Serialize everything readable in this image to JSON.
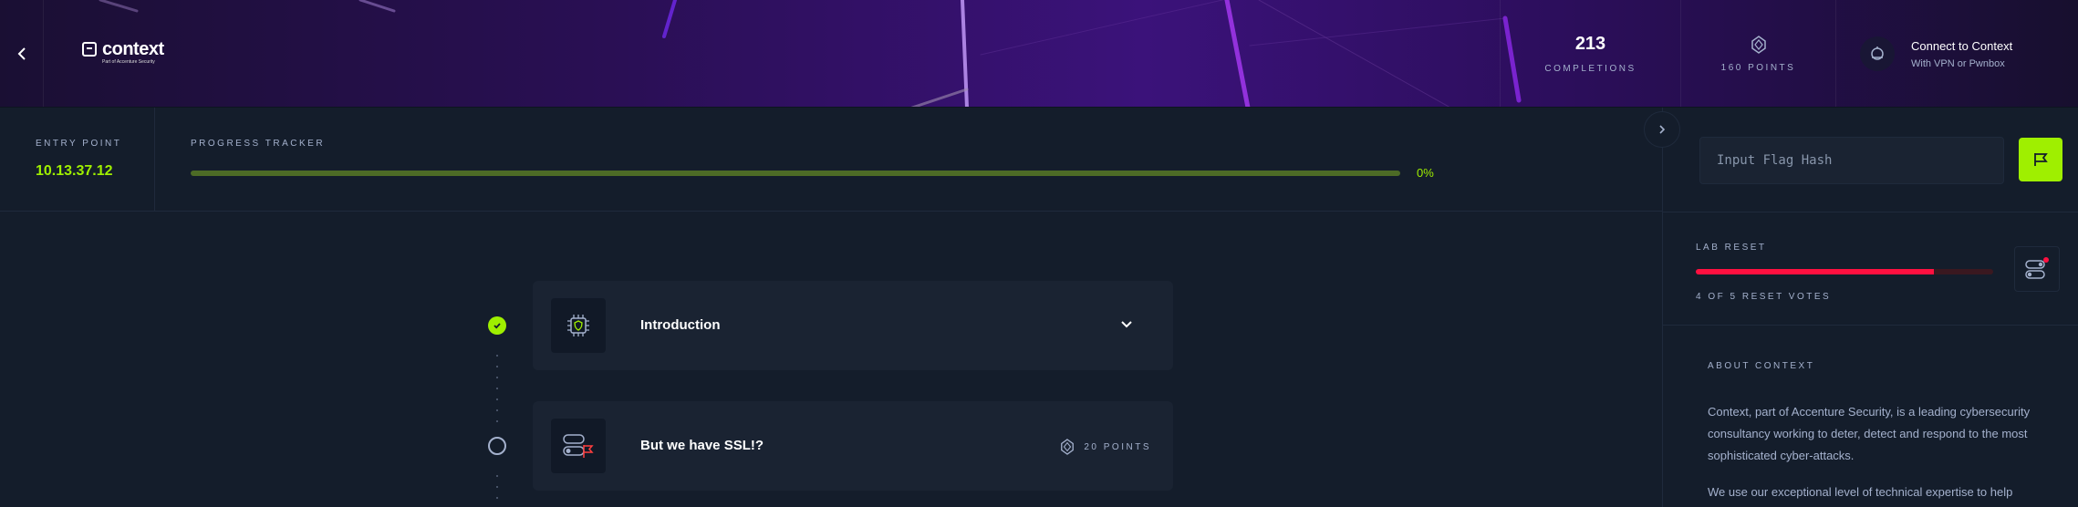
{
  "header": {
    "logo_text": "context",
    "logo_sub": "Part of Accenture Security",
    "completions_value": "213",
    "completions_label": "COMPLETIONS",
    "points_label": "160 POINTS",
    "connect_title": "Connect to Context",
    "connect_sub": "With VPN or Pwnbox"
  },
  "progress": {
    "entry_label": "ENTRY POINT",
    "entry_ip": "10.13.37.12",
    "tracker_label": "PROGRESS TRACKER",
    "tracker_percent": "0%",
    "tracker_value": 0
  },
  "flag": {
    "placeholder": "Input Flag Hash"
  },
  "lab_reset": {
    "label": "LAB RESET",
    "votes_text": "4 OF 5 RESET VOTES",
    "votes": 4,
    "votes_total": 5
  },
  "about": {
    "title": "ABOUT CONTEXT",
    "paragraphs": [
      "Context, part of Accenture Security, is a leading cybersecurity consultancy working to deter, detect and respond to the most sophisticated cyber-attacks.",
      "We use our exceptional level of technical expertise to help"
    ]
  },
  "tasks": [
    {
      "title": "Introduction",
      "completed": true,
      "icon": "chip-shield-icon"
    },
    {
      "title": "But we have SSL!?",
      "completed": false,
      "points": "20 POINTS",
      "icon": "toggle-flag-icon"
    }
  ],
  "colors": {
    "accent": "#9fef00",
    "danger": "#ff1040",
    "background": "#141d2b",
    "panel": "#1a2332"
  }
}
